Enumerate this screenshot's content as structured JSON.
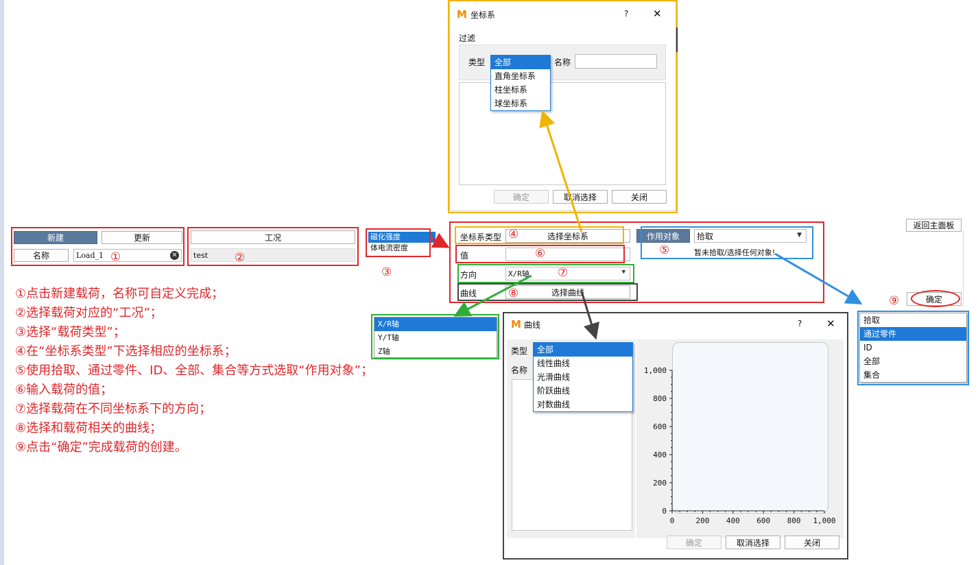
{
  "left_panel": {
    "new_button": "新建",
    "update_button": "更新",
    "name_label": "名称",
    "name_value": "Load_1",
    "case_header": "工况",
    "case_value": "test"
  },
  "load_type_list": {
    "items": [
      "磁化强度",
      "体电流密度"
    ],
    "selected_index": 0
  },
  "main_panel": {
    "coord_type_label": "坐标系类型",
    "select_coord_button": "选择坐标系",
    "value_label": "值",
    "direction_label": "方向",
    "direction_value": "X/R轴",
    "curve_label": "曲线",
    "select_curve_button": "选择曲线",
    "target_button": "作用对象",
    "pick_value": "拾取",
    "pick_status": "暂未拾取/选择任何对象!"
  },
  "right_side": {
    "back_button": "返回主面板",
    "ok_button": "确定"
  },
  "pick_list": {
    "items": [
      "拾取",
      "通过零件",
      "ID",
      "全部",
      "集合"
    ],
    "selected_index": 1
  },
  "direction_list": {
    "items": [
      "X/R轴",
      "Y/T轴",
      "Z轴"
    ],
    "selected_index": 0
  },
  "coord_dialog": {
    "title": "坐标系",
    "help": "?",
    "close": "✕",
    "filter_label": "过滤",
    "type_label": "类型",
    "name_label": "名称",
    "type_options": [
      "全部",
      "直角坐标系",
      "柱坐标系",
      "球坐标系"
    ],
    "selected_index": 0,
    "ok_button": "确定",
    "cancel_button": "取消选择",
    "close_button": "关闭"
  },
  "curve_dialog": {
    "title": "曲线",
    "help": "?",
    "close": "✕",
    "type_label": "类型",
    "name_label": "名称",
    "type_options": [
      "全部",
      "线性曲线",
      "光滑曲线",
      "阶跃曲线",
      "对数曲线"
    ],
    "selected_index": 0,
    "ok_button": "确定",
    "cancel_button": "取消选择",
    "close_button": "关闭"
  },
  "chart_data": {
    "type": "line",
    "series": [],
    "xlim": [
      0,
      1000
    ],
    "ylim": [
      0,
      1000
    ],
    "x_ticks": [
      "0",
      "200",
      "400",
      "600",
      "800",
      "1,000"
    ],
    "y_ticks": [
      "0",
      "200",
      "400",
      "600",
      "800",
      "1,000"
    ],
    "title": "",
    "xlabel": "",
    "ylabel": ""
  },
  "markers": [
    "①",
    "②",
    "③",
    "④",
    "⑤",
    "⑥",
    "⑦",
    "⑧",
    "⑨"
  ],
  "instructions": [
    "①点击新建载荷，名称可自定义完成；",
    "②选择载荷对应的“工况”；",
    "③选择“载荷类型”；",
    "④在“坐标系类型”下选择相应的坐标系；",
    "⑤使用拾取、通过零件、ID、全部、集合等方式选取“作用对象”；",
    "⑥输入载荷的值；",
    "⑦选择载荷在不同坐标系下的方向；",
    "⑧选择和载荷相关的曲线；",
    "⑨点击“确定”完成载荷的创建。"
  ],
  "colors": {
    "red": "#e0262a",
    "orange": "#f2b400",
    "blue": "#2f8fe0",
    "green": "#2fae37",
    "dark": "#444444",
    "selection": "#1e7ad6"
  }
}
